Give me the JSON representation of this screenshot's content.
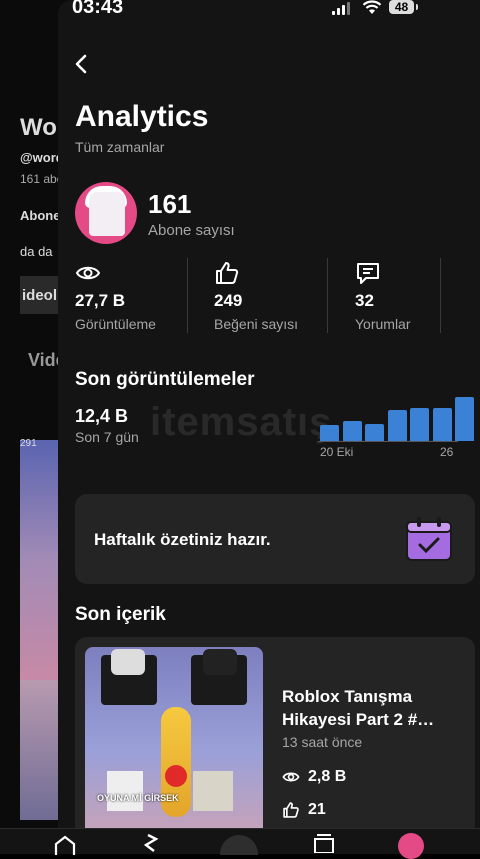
{
  "status_bar": {
    "time": "03:43",
    "battery": "48"
  },
  "background_page": {
    "name_fragment": "Wo",
    "handle_fragment": "@worq",
    "subs_fragment": "161 abo",
    "abone": "Abone",
    "da": "da da",
    "video": "ideol",
    "vid": "Vide",
    "num": "291"
  },
  "header": {
    "title": "Analytics",
    "subtitle": "Tüm zamanlar"
  },
  "subscribers": {
    "value": "161",
    "label": "Abone sayısı"
  },
  "stats": [
    {
      "icon": "eye-icon",
      "value": "27,7 B",
      "label": "Görüntüleme"
    },
    {
      "icon": "thumbs-up-icon",
      "value": "249",
      "label": "Beğeni sayısı"
    },
    {
      "icon": "comment-icon",
      "value": "32",
      "label": "Yorumlar"
    }
  ],
  "recent_views": {
    "title": "Son görüntülemeler",
    "value": "12,4 B",
    "period": "Son 7 gün",
    "chart_data": {
      "type": "bar",
      "values": [
        1.0,
        1.3,
        1.1,
        2.0,
        2.1,
        2.1,
        2.8
      ],
      "x_tick_labels": [
        "20 Eki",
        "26"
      ]
    }
  },
  "summary_card": {
    "text": "Haftalık özetiniz hazır."
  },
  "recent_content": {
    "title": "Son içerik",
    "item": {
      "title": "Roblox Tanışma Hikayesi Part 2 #…",
      "time": "13 saat önce",
      "views": "2,8 B",
      "likes": "21",
      "thumb_caption": "OYUNA Mİ GİRSEK"
    }
  },
  "watermark": "itemsatış",
  "colors": {
    "accent": "#3b82d6",
    "card": "#242424",
    "sheet": "#141414",
    "muted": "#a6a6a6"
  }
}
